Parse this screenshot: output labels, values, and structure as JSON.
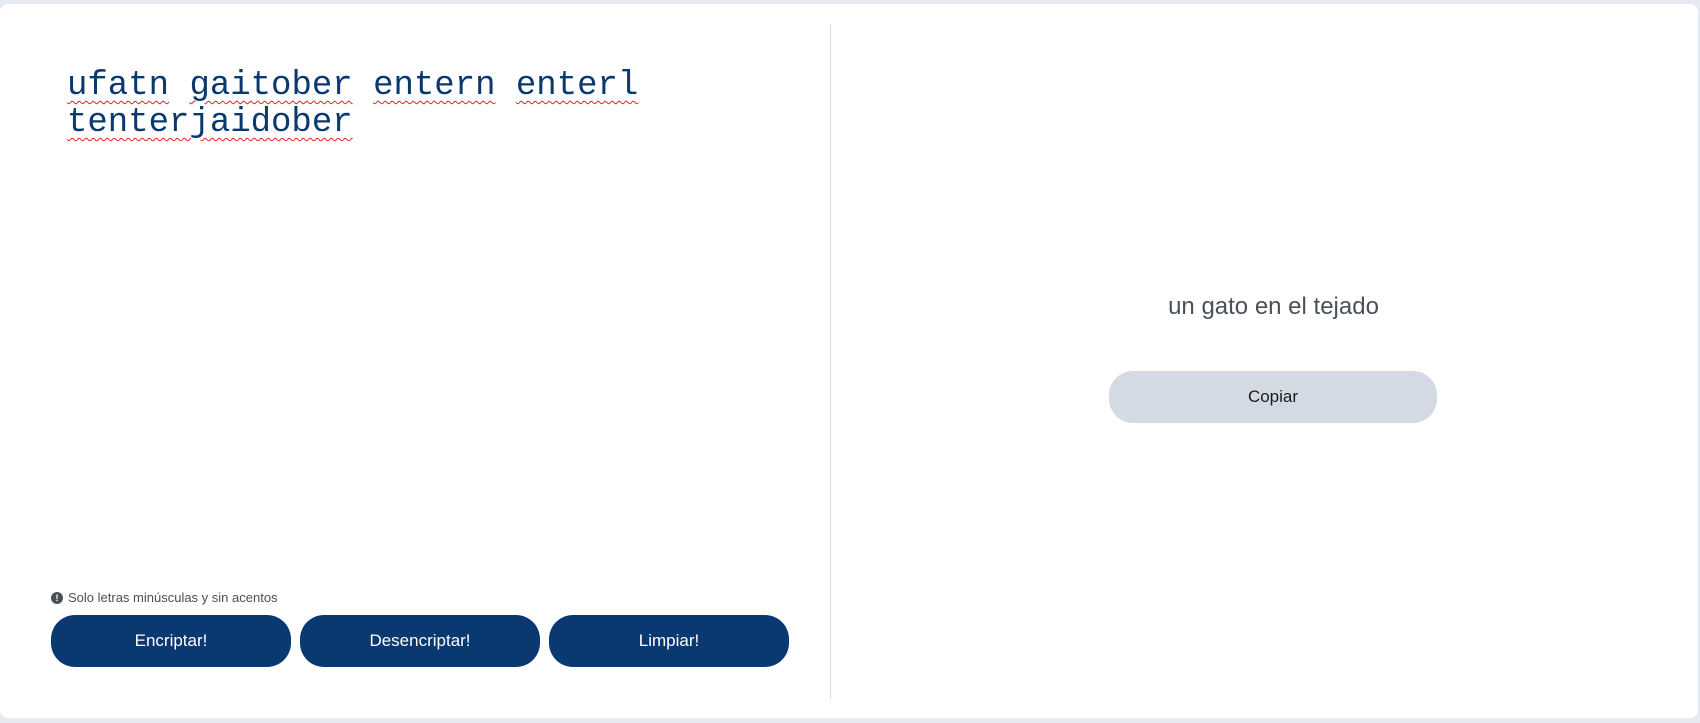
{
  "input": {
    "words": [
      "ufatn",
      "gaitober",
      "entern",
      "enterl",
      "tenterjaidober"
    ]
  },
  "hint": {
    "icon": "exclamation-circle-icon",
    "text": "Solo letras minúsculas y sin acentos"
  },
  "buttons": {
    "encrypt": "Encriptar!",
    "decrypt": "Desencriptar!",
    "clear": "Limpiar!"
  },
  "output": {
    "text": "un gato en el tejado",
    "copy_label": "Copiar"
  },
  "colors": {
    "primary": "#0a3871",
    "secondary": "#d3dae3",
    "text_muted": "#495057",
    "background": "#e5eaf1",
    "spellcheck": "#e02020"
  }
}
